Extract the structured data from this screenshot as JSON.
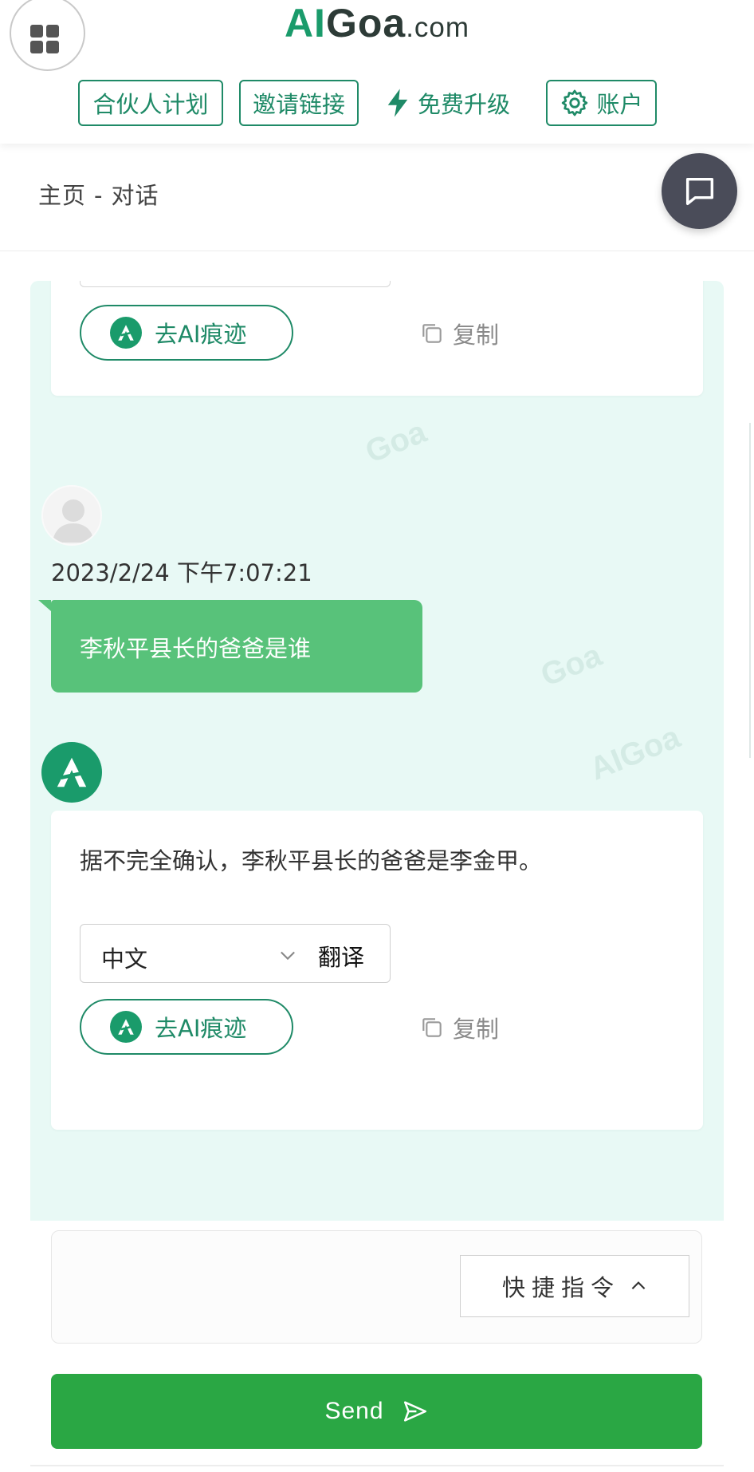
{
  "header": {
    "logo_ai": "AI",
    "logo_goa": "Goa",
    "logo_com": ".com",
    "nav": {
      "partner": "合伙人计划",
      "invite": "邀请链接",
      "upgrade": "免费升级",
      "account": "账户"
    }
  },
  "breadcrumb": {
    "home": "主页",
    "separator": "-",
    "current": "对话"
  },
  "chat": {
    "previous_card": {
      "trace_label": "去AI痕迹",
      "copy_label": "复制"
    },
    "user_message": {
      "timestamp": "2023/2/24 下午7:07:21",
      "text": "李秋平县长的爸爸是谁"
    },
    "ai_message": {
      "text": "据不完全确认，李秋平县长的爸爸是李金甲。",
      "language": "中文",
      "translate_label": "翻译",
      "trace_label": "去AI痕迹",
      "copy_label": "复制"
    }
  },
  "input": {
    "placeholder": "",
    "quick_commands_label": "快捷指令"
  },
  "send_label": "Send",
  "colors": {
    "brand_green": "#1a9b6b",
    "bubble_green": "#58c27a",
    "send_green": "#2aa744",
    "chat_bg": "#e8f9f5"
  },
  "icons": {
    "apps": "apps-grid-icon",
    "upgrade": "lightning-icon",
    "account": "gear-icon",
    "fab": "chat-bubble-icon",
    "copy": "copy-icon",
    "chevron": "chevron-down-icon",
    "quick_cmd": "chevron-up-icon",
    "send": "paper-plane-icon"
  }
}
